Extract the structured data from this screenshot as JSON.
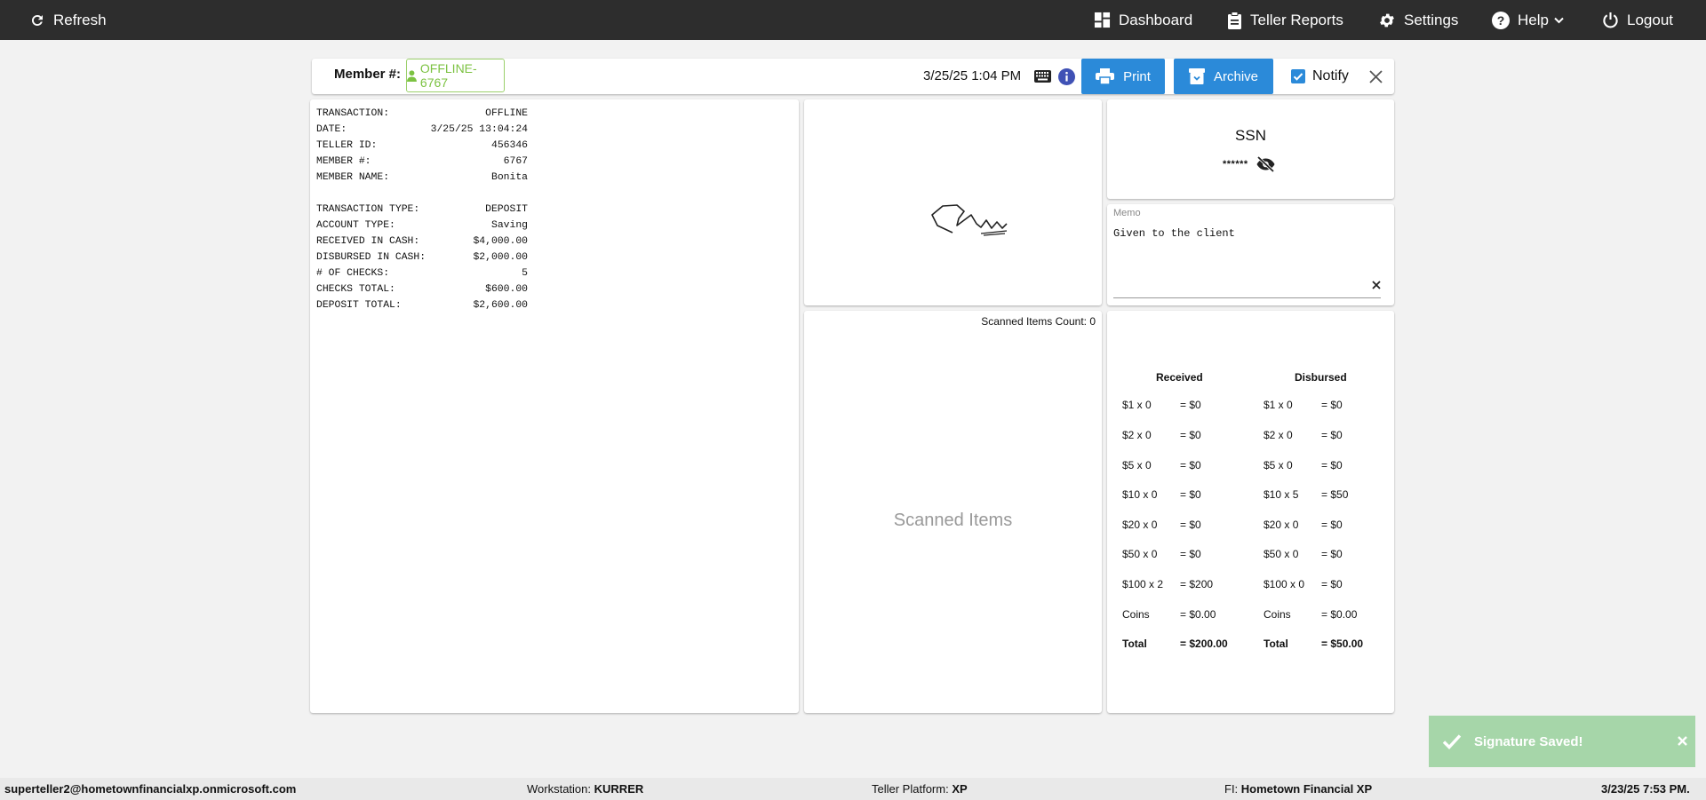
{
  "nav": {
    "refresh_label": "Refresh",
    "dashboard_label": "Dashboard",
    "teller_reports_label": "Teller Reports",
    "settings_label": "Settings",
    "help_label": "Help",
    "logout_label": "Logout"
  },
  "header": {
    "member_label": "Member #:",
    "member_value": "OFFLINE-6767",
    "datetime": "3/25/25 1:04 PM",
    "print_label": "Print",
    "archive_label": "Archive",
    "notify_label": "Notify",
    "notify_checked": true
  },
  "receipt": {
    "lines": [
      {
        "label": "TRANSACTION:",
        "value": "OFFLINE"
      },
      {
        "label": "DATE:",
        "value": "3/25/25 13:04:24"
      },
      {
        "label": "TELLER ID:",
        "value": "456346"
      },
      {
        "label": "MEMBER #:",
        "value": "6767"
      },
      {
        "label": "MEMBER NAME:",
        "value": "Bonita"
      },
      {
        "label": "TRANSACTION TYPE:",
        "value": "DEPOSIT"
      },
      {
        "label": "ACCOUNT TYPE:",
        "value": "Saving"
      },
      {
        "label": "RECEIVED IN CASH:",
        "value": "$4,000.00"
      },
      {
        "label": "DISBURSED IN CASH:",
        "value": "$2,000.00"
      },
      {
        "label": "# OF CHECKS:",
        "value": "5"
      },
      {
        "label": "CHECKS TOTAL:",
        "value": "$600.00"
      },
      {
        "label": "DEPOSIT TOTAL:",
        "value": "$2,600.00"
      }
    ]
  },
  "ssn": {
    "title": "SSN",
    "masked": "******"
  },
  "memo": {
    "label": "Memo",
    "value": "Given to the client"
  },
  "scanned": {
    "count_label": "Scanned Items Count: 0",
    "placeholder": "Scanned Items"
  },
  "cash": {
    "received_header": "Received",
    "disbursed_header": "Disbursed",
    "rows": [
      {
        "r_denom": "$1 x 0",
        "r_total": "= $0",
        "d_denom": "$1 x 0",
        "d_total": "= $0"
      },
      {
        "r_denom": "$2 x 0",
        "r_total": "= $0",
        "d_denom": "$2 x 0",
        "d_total": "= $0"
      },
      {
        "r_denom": "$5 x 0",
        "r_total": "= $0",
        "d_denom": "$5 x 0",
        "d_total": "= $0"
      },
      {
        "r_denom": "$10 x 0",
        "r_total": "= $0",
        "d_denom": "$10 x 5",
        "d_total": "= $50"
      },
      {
        "r_denom": "$20 x 0",
        "r_total": "= $0",
        "d_denom": "$20 x 0",
        "d_total": "= $0"
      },
      {
        "r_denom": "$50 x 0",
        "r_total": "= $0",
        "d_denom": "$50 x 0",
        "d_total": "= $0"
      },
      {
        "r_denom": "$100 x 2",
        "r_total": "= $200",
        "d_denom": "$100 x 0",
        "d_total": "= $0"
      },
      {
        "r_denom": "Coins",
        "r_total": "= $0.00",
        "d_denom": "Coins",
        "d_total": "= $0.00"
      }
    ],
    "total": {
      "r_label": "Total",
      "r_value": "= $200.00",
      "d_label": "Total",
      "d_value": "= $50.00"
    }
  },
  "toast": {
    "message": "Signature Saved!"
  },
  "footer": {
    "user": "superteller2@hometownfinancialxp.onmicrosoft.com",
    "workstation_label": "Workstation:",
    "workstation_value": "KURRER",
    "platform_label": "Teller Platform:",
    "platform_value": "XP",
    "fi_label": "FI:",
    "fi_value": "Hometown Financial XP",
    "datetime": "3/23/25 7:53 PM."
  },
  "colors": {
    "topbar": "#2d2d2d",
    "button": "#2b8ad9",
    "member_green": "#7cc242",
    "toast": "#a6d6a9"
  }
}
